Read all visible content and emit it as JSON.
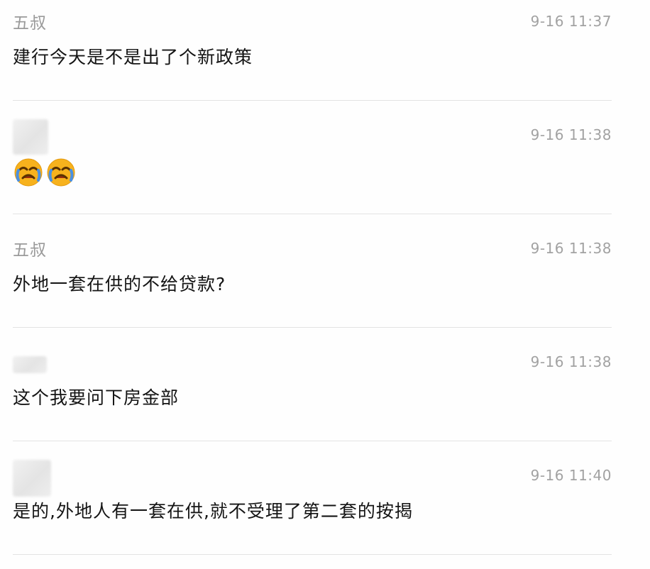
{
  "messages": [
    {
      "sender": "五叔",
      "time": "9-16 11:37",
      "text": "建行今天是不是出了个新政策"
    },
    {
      "sender": "",
      "time": "9-16 11:38",
      "emojis": [
        "crying-face",
        "crying-face"
      ]
    },
    {
      "sender": "五叔",
      "time": "9-16 11:38",
      "text": "外地一套在供的不给贷款?"
    },
    {
      "sender": "",
      "time": "9-16 11:38",
      "text": "这个我要问下房金部"
    },
    {
      "sender": "",
      "time": "9-16 11:40",
      "text": "是的,外地人有一套在供,就不受理了第二套的按揭"
    }
  ],
  "colors": {
    "name": "#9a9a9a",
    "time": "#a2a2a2",
    "text": "#141414",
    "divider": "#e3e3e3",
    "background": "#fefefe",
    "emoji_face": "#f7b21d"
  }
}
